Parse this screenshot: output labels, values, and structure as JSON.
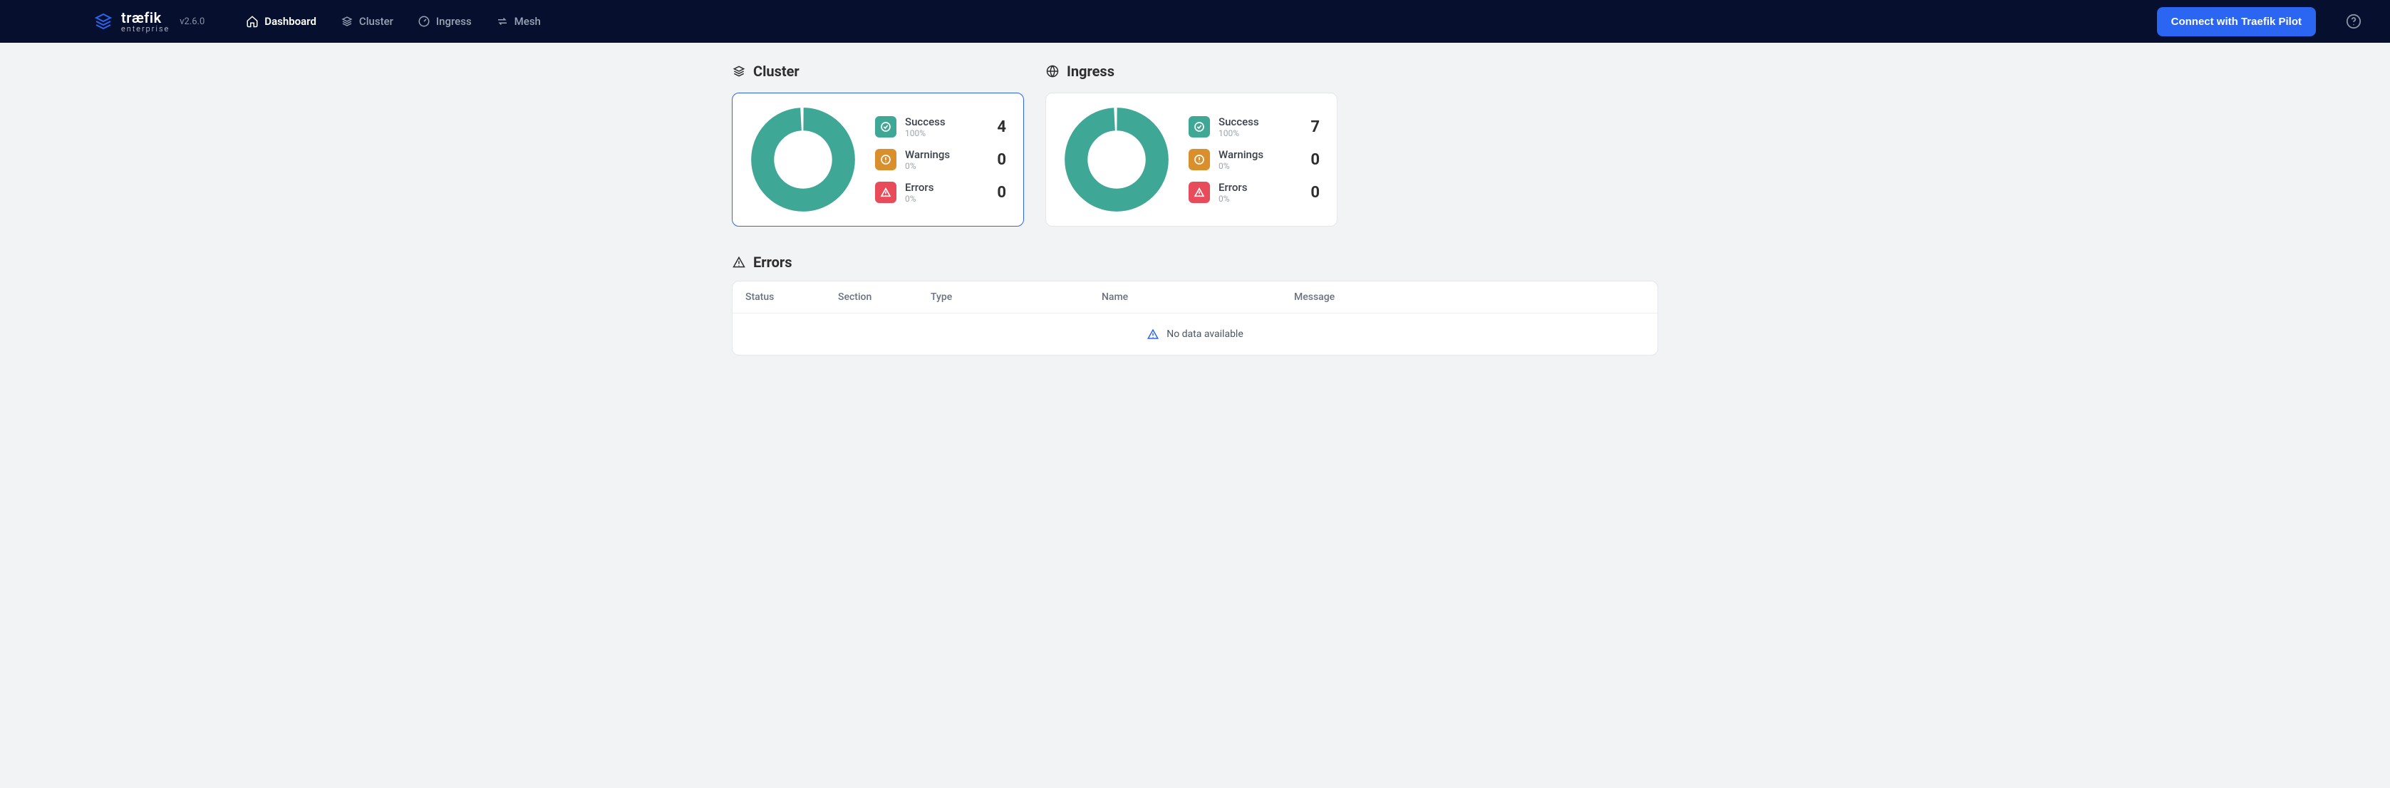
{
  "brand": {
    "line1": "træfik",
    "line2": "enterprise"
  },
  "version": "v2.6.0",
  "nav": {
    "dashboard": "Dashboard",
    "cluster": "Cluster",
    "ingress": "Ingress",
    "mesh": "Mesh"
  },
  "connect_button": "Connect with Traefik Pilot",
  "sections": {
    "cluster": {
      "title": "Cluster",
      "success": {
        "label": "Success",
        "pct": "100%",
        "count": "4"
      },
      "warnings": {
        "label": "Warnings",
        "pct": "0%",
        "count": "0"
      },
      "errors": {
        "label": "Errors",
        "pct": "0%",
        "count": "0"
      }
    },
    "ingress": {
      "title": "Ingress",
      "success": {
        "label": "Success",
        "pct": "100%",
        "count": "7"
      },
      "warnings": {
        "label": "Warnings",
        "pct": "0%",
        "count": "0"
      },
      "errors": {
        "label": "Errors",
        "pct": "0%",
        "count": "0"
      }
    }
  },
  "errors_table": {
    "title": "Errors",
    "columns": {
      "status": "Status",
      "section": "Section",
      "type": "Type",
      "name": "Name",
      "message": "Message"
    },
    "empty": "No data available"
  },
  "chart_data": [
    {
      "type": "pie",
      "title": "Cluster",
      "categories": [
        "Success",
        "Warnings",
        "Errors"
      ],
      "values": [
        4,
        0,
        0
      ],
      "colors": [
        "#3fa796",
        "#d98f2b",
        "#e84b5a"
      ]
    },
    {
      "type": "pie",
      "title": "Ingress",
      "categories": [
        "Success",
        "Warnings",
        "Errors"
      ],
      "values": [
        7,
        0,
        0
      ],
      "colors": [
        "#3fa796",
        "#d98f2b",
        "#e84b5a"
      ]
    }
  ]
}
